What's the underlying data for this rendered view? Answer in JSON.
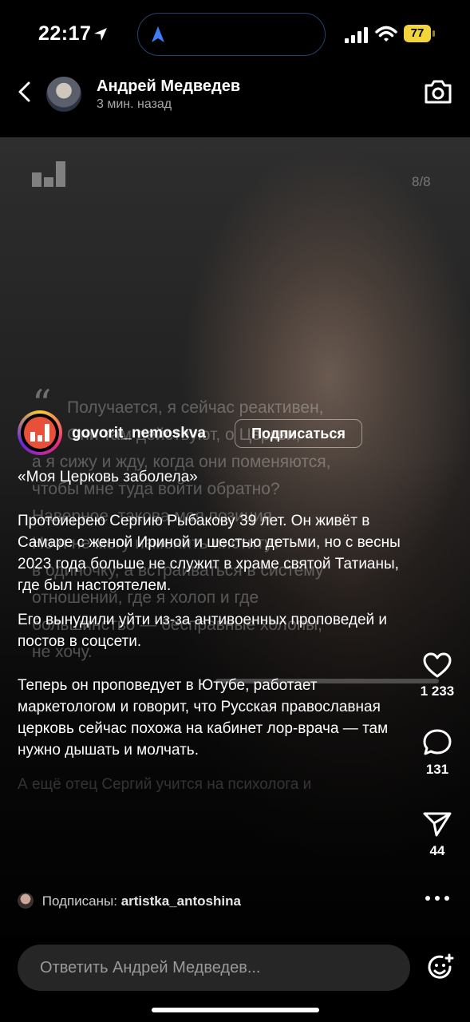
{
  "status_bar": {
    "time": "22:17",
    "battery": "77",
    "icons": [
      "location-arrow-icon",
      "navigation-arrow-icon",
      "signal-icon",
      "wifi-icon",
      "battery-icon"
    ]
  },
  "header": {
    "author": "Андрей Медведев",
    "time_ago": "3 мин. назад",
    "icons": [
      "back-icon",
      "camera-icon"
    ]
  },
  "story": {
    "page_counter": "8/8",
    "quote_mark": "“",
    "quote_lines": [
      "Получается, я сейчас реактивен,",
      "Они там действуют, о Церкви,",
      "а я сижу и жду, когда они поменяются,",
      "чтобы мне туда войти обратно?",
      "Наверное, такова моя позиция.",
      "Но я не могу изменить институт",
      "в одиночку, а встраиваться в систему",
      "отношений, где я холоп и где",
      "большинство — бесправные холопы,",
      "не хочу."
    ]
  },
  "account": {
    "username": "govorit_nemoskva",
    "follow_label": "Подписаться"
  },
  "caption": {
    "title": "«Моя Церковь заболела»",
    "p1": "Протоиерею Сергию Рыбакову 39 лет. Он живёт в Самаре с женой Ириной и шестью детьми, но с весны 2023 года больше не служит в храме святой Татианы, где был настоятелем.",
    "p2": "Его вынудили уйти из-за антивоенных проповедей и постов в соцсети.",
    "p3": "Теперь он проповедует в Ютубе, работает маркетологом и говорит, что Русская православная церковь сейчас похожа на кабинет лор-врача — там нужно дышать и молчать.",
    "p4": "А ещё отец Сергий учится на психолога и"
  },
  "actions": {
    "likes": "1 233",
    "comments": "131",
    "shares": "44"
  },
  "followed_by": {
    "prefix": "Подписаны:",
    "user": "artistka_antoshina"
  },
  "reply": {
    "placeholder": "Ответить Андрей Медведев..."
  },
  "colors": {
    "background": "#000000",
    "battery": "#f2d43c",
    "island_border": "#27406e",
    "brand_logo": "#e8503a",
    "reply_bg": "#262626"
  }
}
